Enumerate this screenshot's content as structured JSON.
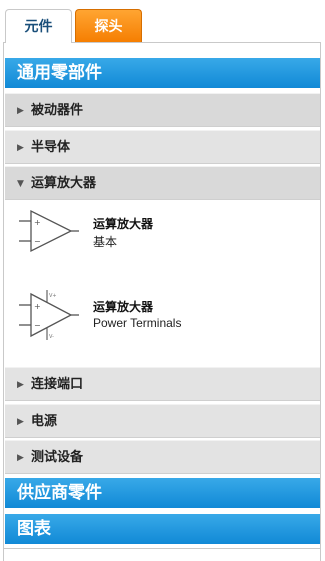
{
  "tabs": [
    {
      "label": "元件",
      "active": true
    },
    {
      "label": "探头",
      "active": false
    }
  ],
  "sections": {
    "common": "通用零部件",
    "vendor": "供应商零件",
    "charts": "图表"
  },
  "categories": {
    "passive": "被动器件",
    "semiconductor": "半导体",
    "opamp": "运算放大器",
    "connectors": "连接端口",
    "power": "电源",
    "test": "测试设备"
  },
  "opamp_items": [
    {
      "title": "运算放大器",
      "subtitle": "基本",
      "icon": "opamp-basic-icon"
    },
    {
      "title": "运算放大器",
      "subtitle": "Power Terminals",
      "icon": "opamp-power-icon"
    }
  ],
  "colors": {
    "section_blue": "#1a9ae0",
    "active_tab_text": "#1a4f7a",
    "probe_tab_orange": "#f8900f",
    "category_gray": "#e3e3e3"
  }
}
